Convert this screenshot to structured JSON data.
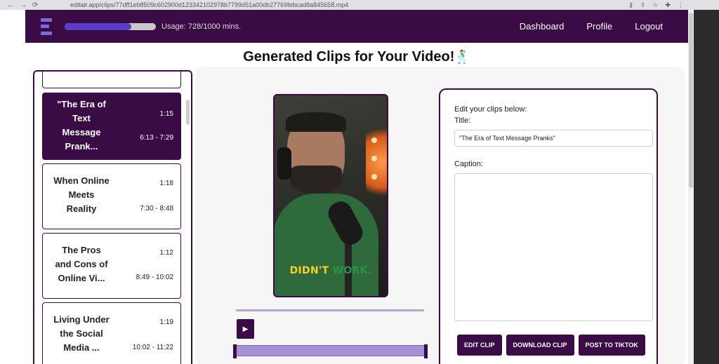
{
  "browser": {
    "url": "editair.app/clips/77dff1eb8509c602900d123342102978b7799d51a00db27769febcad8a845658.mp4",
    "back_icon": "←",
    "forward_icon": "→",
    "reload_icon": "⟳",
    "lock_icon": "🔒"
  },
  "topnav": {
    "usage_fraction": 0.728,
    "usage_text": "Usage: 728/1000 mins.",
    "links": [
      "Dashboard",
      "Profile",
      "Logout"
    ]
  },
  "page": {
    "title": "Generated Clips for Your Video!",
    "title_emoji": "🕺"
  },
  "clips": [
    {
      "title_lines": [
        "\"The Era of",
        "Text",
        "Message",
        "Prank..."
      ],
      "duration": "1:15",
      "range": "6:13 - 7:29",
      "active": true
    },
    {
      "title_lines": [
        "When Online",
        "Meets",
        "Reality"
      ],
      "duration": "1:18",
      "range": "7:30 - 8:48",
      "active": false
    },
    {
      "title_lines": [
        "The Pros",
        "and Cons of",
        "Online Vi..."
      ],
      "duration": "1:12",
      "range": "8:49 - 10:02",
      "active": false
    },
    {
      "title_lines": [
        "Living Under",
        "the Social",
        "Media ..."
      ],
      "duration": "1:19",
      "range": "10:02 - 11:22",
      "active": false
    }
  ],
  "video": {
    "caption_yellow": "DIDN'T",
    "caption_green": "WORK."
  },
  "editor": {
    "heading": "Edit your clips below:",
    "title_label": "Title:",
    "title_value": "\"The Era of Text Message Pranks\"",
    "caption_label": "Caption:",
    "caption_value": "",
    "buttons": {
      "edit": "EDIT CLIP",
      "download": "DOWNLOAD CLIP",
      "post": "POST TO TIKTOK"
    }
  },
  "colors": {
    "brand": "#3a0b45",
    "accent": "#5a3ec8",
    "timeline": "#a68fd4"
  }
}
